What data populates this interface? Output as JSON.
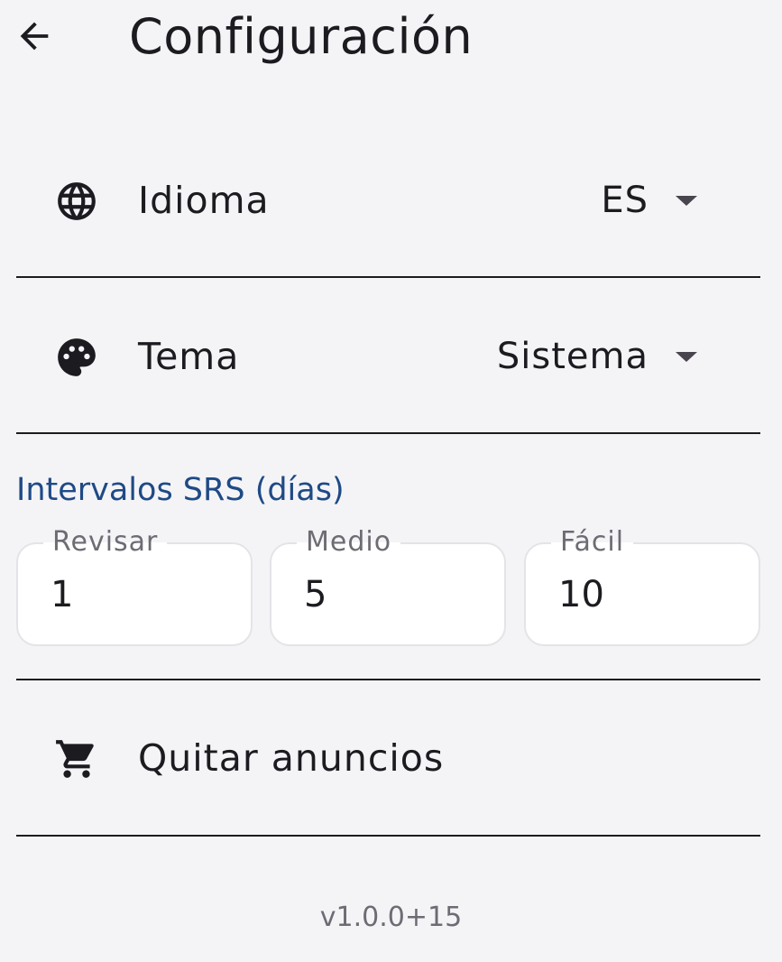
{
  "app_bar": {
    "title": "Configuración",
    "back_icon": "arrow-back-icon"
  },
  "settings": {
    "language": {
      "label": "Idioma",
      "icon": "globe-icon",
      "selected": "ES"
    },
    "theme": {
      "label": "Tema",
      "icon": "palette-icon",
      "selected": "Sistema"
    }
  },
  "srs": {
    "title": "Intervalos SRS (días)",
    "fields": [
      {
        "label": "Revisar",
        "value": "1"
      },
      {
        "label": "Medio",
        "value": "5"
      },
      {
        "label": "Fácil",
        "value": "10"
      }
    ]
  },
  "remove_ads": {
    "label": "Quitar anuncios",
    "icon": "cart-icon"
  },
  "version": "v1.0.0+15",
  "colors": {
    "background": "#f4f4f7",
    "section_title": "#1f4a85",
    "text": "#1c1b1f",
    "muted": "#6e6b73"
  }
}
